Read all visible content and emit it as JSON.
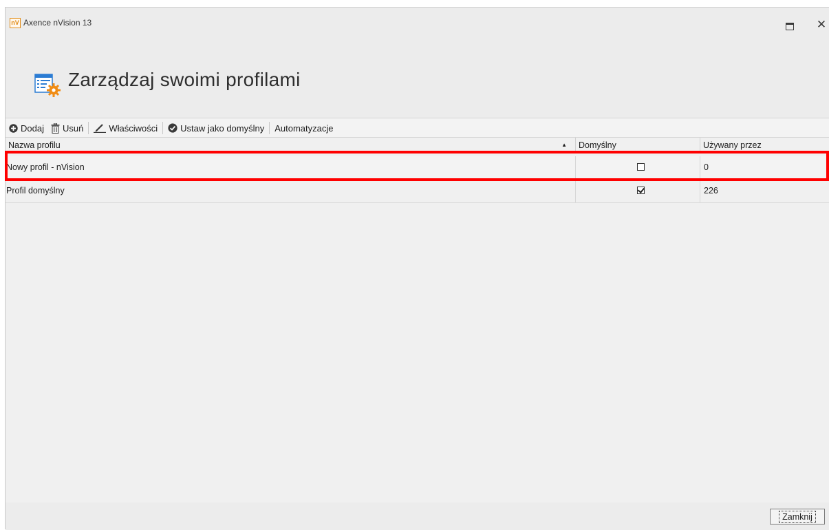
{
  "window": {
    "logo": "nV",
    "title": "Axence nVision 13",
    "maximize_icon": "maximize-icon",
    "close_icon": "close-icon"
  },
  "header": {
    "icon": "profile-settings-icon",
    "title": "Zarządzaj swoimi profilami"
  },
  "toolbar": {
    "add": {
      "label": "Dodaj",
      "icon": "add-circle-icon"
    },
    "remove": {
      "label": "Usuń",
      "icon": "trash-icon"
    },
    "properties": {
      "label": "Właściwości",
      "icon": "pencil-icon"
    },
    "set_default": {
      "label": "Ustaw jako domyślny",
      "icon": "check-circle-icon"
    },
    "automation": {
      "label": "Automatyzacje"
    }
  },
  "grid": {
    "columns": {
      "name": "Nazwa profilu",
      "default": "Domyślny",
      "used_by": "Używany przez"
    },
    "sort": {
      "column": "name",
      "direction": "ascending"
    },
    "rows": [
      {
        "name": "Nowy profil - nVision",
        "default": false,
        "used_by": "0",
        "highlighted": true
      },
      {
        "name": "Profil domyślny",
        "default": true,
        "used_by": "226",
        "highlighted": false
      }
    ]
  },
  "footer": {
    "close_label": "Zamknij"
  },
  "colors": {
    "highlight": "#ff0000",
    "accent": "#2b7cd3",
    "brand": "#e08a14"
  }
}
